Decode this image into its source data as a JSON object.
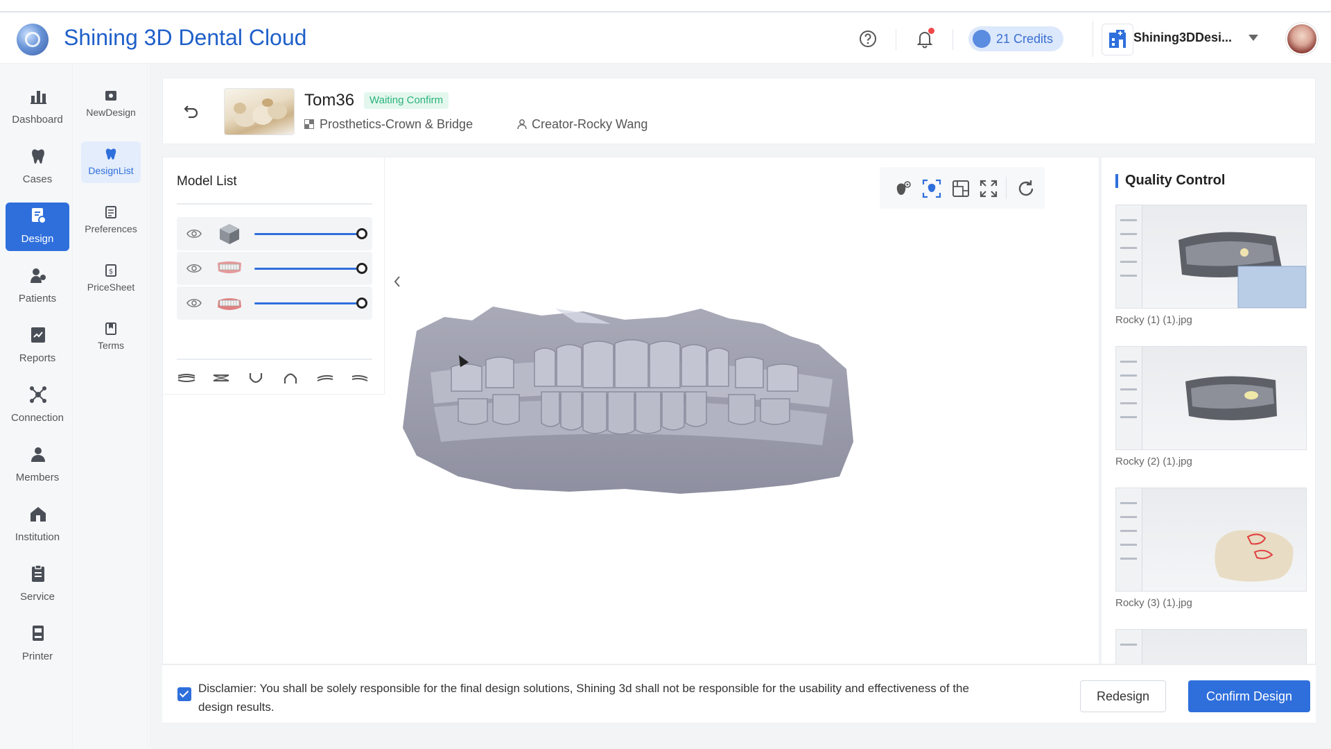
{
  "header": {
    "app_title": "Shining 3D Dental Cloud",
    "credits": "21 Credits",
    "org_name": "Shining3DDesi...",
    "icons": [
      "help-icon",
      "bell-icon"
    ]
  },
  "left_nav": [
    {
      "label": "Dashboard",
      "icon": "bar-chart-icon",
      "active": false
    },
    {
      "label": "Cases",
      "icon": "tooth-icon",
      "active": false
    },
    {
      "label": "Design",
      "icon": "design-icon",
      "active": true
    },
    {
      "label": "Patients",
      "icon": "patients-icon",
      "active": false
    },
    {
      "label": "Reports",
      "icon": "reports-icon",
      "active": false
    },
    {
      "label": "Connection",
      "icon": "connection-icon",
      "active": false
    },
    {
      "label": "Members",
      "icon": "members-icon",
      "active": false
    },
    {
      "label": "Institution",
      "icon": "institution-icon",
      "active": false
    },
    {
      "label": "Service",
      "icon": "service-icon",
      "active": false
    },
    {
      "label": "Printer",
      "icon": "printer-icon",
      "active": false
    }
  ],
  "sub_nav": [
    {
      "label": "NewDesign",
      "active": false
    },
    {
      "label": "DesignList",
      "active": true
    },
    {
      "label": "Preferences",
      "active": false
    },
    {
      "label": "PriceSheet",
      "active": false
    },
    {
      "label": "Terms",
      "active": false
    }
  ],
  "case": {
    "name": "Tom36",
    "status": "Waiting Confirm",
    "type": "Prosthetics-Crown & Bridge",
    "creator": "Creator-Rocky Wang"
  },
  "model_list": {
    "title": "Model List",
    "models": [
      {
        "icon": "cube-model-icon",
        "opacity": 1.0
      },
      {
        "icon": "upper-jaw-model-icon",
        "opacity": 1.0
      },
      {
        "icon": "lower-jaw-model-icon",
        "opacity": 1.0
      }
    ],
    "view_buttons": [
      "view-front-icon",
      "view-back-icon",
      "view-bottom-icon",
      "view-top-icon",
      "view-left-icon",
      "view-right-icon"
    ]
  },
  "toolbar": [
    "eye-toggle-icon",
    "focus-select-icon",
    "layers-icon",
    "fullscreen-icon",
    "refresh-icon"
  ],
  "quality_control": {
    "title": "Quality Control",
    "images": [
      {
        "caption": "Rocky (1) (1).jpg"
      },
      {
        "caption": "Rocky (2) (1).jpg"
      },
      {
        "caption": "Rocky (3) (1).jpg"
      }
    ]
  },
  "footer": {
    "disclaimer": "Disclamier:  You shall be solely responsible for the final design solutions, Shining 3d shall not be responsible for the usability and effectiveness of the design results.",
    "checked": true,
    "redesign_label": "Redesign",
    "confirm_label": "Confirm Design"
  },
  "colors": {
    "accent": "#2f6fdc",
    "status_green": "#2bb37a"
  }
}
